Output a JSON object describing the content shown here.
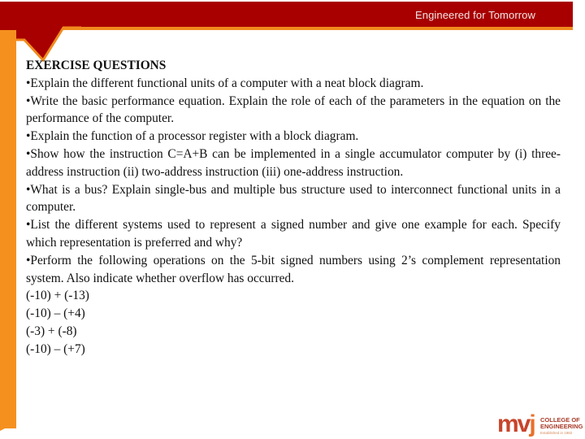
{
  "header": {
    "tagline": "Engineered for Tomorrow",
    "colors": {
      "band": "#a80000",
      "accent": "#f08a1e"
    }
  },
  "content": {
    "title": "EXERCISE QUESTIONS",
    "bullets": [
      "•Explain the different functional units of a computer with a neat block diagram.",
      "•Write the basic performance equation. Explain the role of each of the parameters in the equation on the performance of the computer.",
      "•Explain the function of a processor register with a block diagram.",
      "•Show how the instruction C=A+B can be implemented in a single accumulator computer by (i) three-address instruction (ii) two-address instruction (iii) one-address instruction.",
      "•What is a bus? Explain single-bus and multiple bus structure used to interconnect functional units in a computer.",
      "•List the different systems used to represent a signed number and give one example for each. Specify which representation is preferred and why?",
      "•Perform the following operations on the 5-bit signed numbers using 2’s complement representation system. Also indicate whether overflow has occurred."
    ],
    "operations": [
      "(-10) + (-13)",
      "(-10) – (+4)",
      "(-3) + (-8)",
      "(-10) – (+7)"
    ]
  },
  "logo": {
    "mark_main": "mv",
    "mark_accent": "j",
    "line1": "COLLEGE OF",
    "line2": "ENGINEERING",
    "subline": "Established in 1982"
  }
}
